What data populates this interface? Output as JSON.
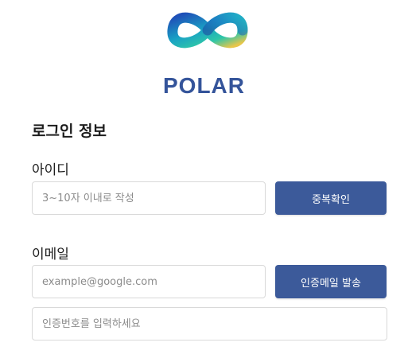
{
  "brand": {
    "logo_icon": "infinity-logo-icon",
    "name": "POLAR",
    "color": "#34549a"
  },
  "form": {
    "section_title": "로그인 정보",
    "id_field": {
      "label": "아이디",
      "value": "",
      "placeholder": "3~10자 이내로 작성",
      "button_label": "중복확인"
    },
    "email_field": {
      "label": "이메일",
      "value": "",
      "placeholder": "example@google.com",
      "button_label": "인증메일 발송"
    },
    "verification_field": {
      "value": "",
      "placeholder": "인증번호를 입력하세요"
    }
  },
  "colors": {
    "button_bg": "#3c5a9a",
    "button_text": "#ffffff",
    "input_border": "#d9d9d9"
  }
}
